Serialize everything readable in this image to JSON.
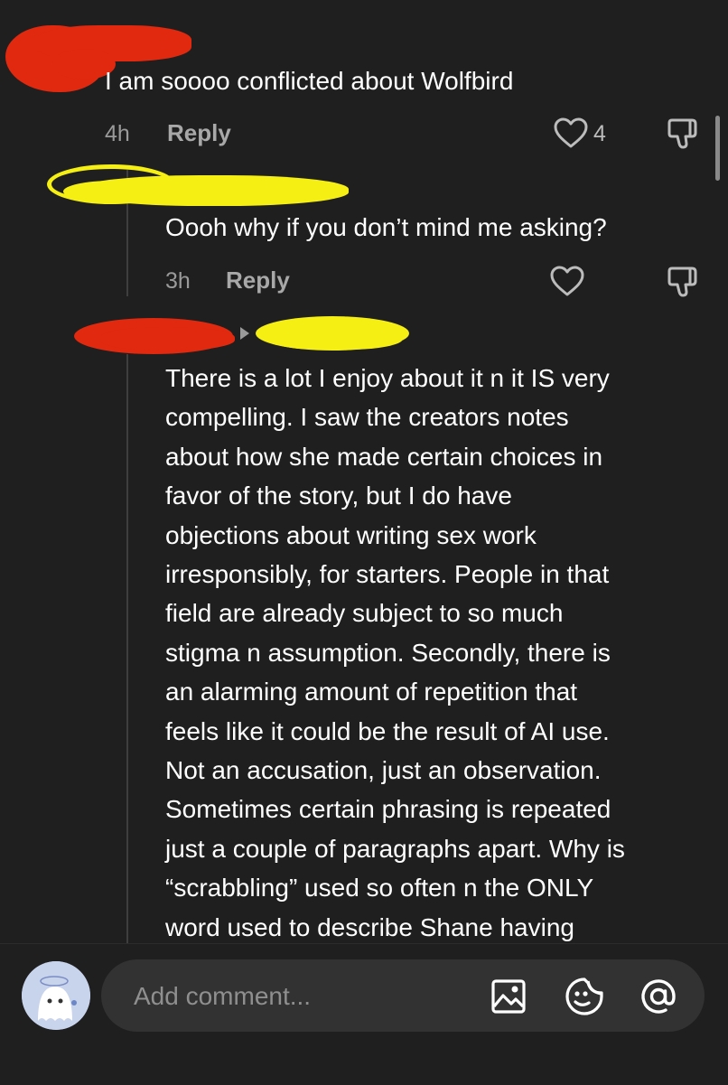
{
  "comments": [
    {
      "text": "I am soooo conflicted about Wolfbird",
      "time": "4h",
      "reply_label": "Reply",
      "like_count": "4"
    },
    {
      "text": "Oooh why if you don’t mind me asking?",
      "time": "3h",
      "reply_label": "Reply"
    },
    {
      "lines": [
        "There is a lot I enjoy about it n it IS very",
        "compelling. I saw the creators notes",
        "about how she made certain choices in",
        "favor of the story, but I do have",
        "objections about writing sex work",
        "irresponsibly, for starters. People in that",
        "field are already subject to so much",
        "stigma n assumption. Secondly, there is",
        "an alarming amount of repetition that",
        "feels like it could be the result of AI use.",
        "Not an accusation, just an observation.",
        "Sometimes certain phrasing is repeated",
        "just a couple of paragraphs apart. Why is",
        "“scrabbling” used so often n the ONLY",
        "word used to describe Shane having"
      ]
    }
  ],
  "composer": {
    "placeholder": "Add comment..."
  },
  "icons": {
    "like": "heart-icon",
    "dislike": "thumbs-down-icon",
    "image": "image-icon",
    "emoji": "emoji-icon",
    "mention": "at-icon",
    "reply_arrow": "triangle-right-icon"
  },
  "colors": {
    "background": "#1f1f1f",
    "redaction_red": "#e0290f",
    "redaction_yellow": "#f5ef14",
    "muted_text": "#9a9a9a",
    "input_bg": "#323232"
  }
}
